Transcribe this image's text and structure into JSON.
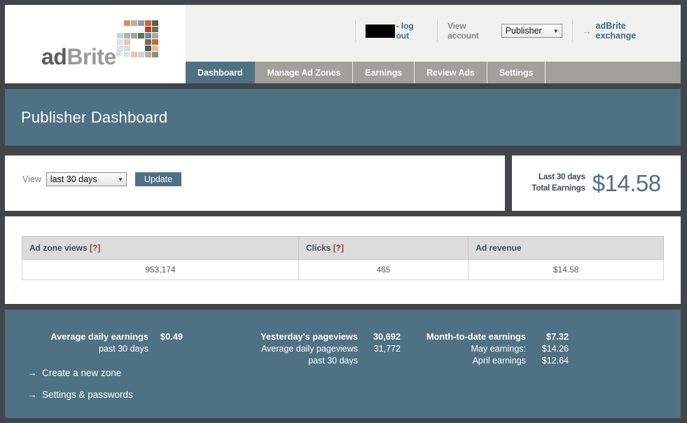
{
  "brand": {
    "logo_text_dark": "ad",
    "logo_text_light": "Brite",
    "logo_registered": "®",
    "logo_colors": [
      "#ffffff",
      "#d98f6a",
      "#b3b0a5",
      "#8aa0b0",
      "#c4673c",
      "#5a5c47",
      "#ffffff",
      "#ffffff",
      "#ffffff",
      "#ffffff",
      "#b5431a",
      "#6d6e55",
      "#c9d3da",
      "#b0b3ab",
      "#9ba79e",
      "#6d6e55",
      "#6b8ca3",
      "#a8a99c",
      "#dfe3e6",
      "#e7c6b4",
      "#ffffff",
      "#ffffff",
      "#6d6e55",
      "#c4673c",
      "#dfe3e6",
      "#d7dbde",
      "#ffffff",
      "#ffffff",
      "#5a5c47",
      "#e8b79c",
      "#ffffff",
      "#dfe3e6",
      "#e7c6b4",
      "#c9d3da",
      "#b3b0a5",
      "#8f9177"
    ]
  },
  "header": {
    "username_redacted": "",
    "logout_label": "- log out",
    "view_account_label": "View account",
    "account_select": {
      "value": "Publisher",
      "caret": "▼"
    },
    "exchange_arrow": "→",
    "exchange_label": "adBrite exchange"
  },
  "nav": {
    "tabs": [
      {
        "label": "Dashboard",
        "active": true
      },
      {
        "label": "Manage Ad Zones",
        "active": false
      },
      {
        "label": "Earnings",
        "active": false
      },
      {
        "label": "Review Ads",
        "active": false
      },
      {
        "label": "Settings",
        "active": false
      }
    ]
  },
  "page_title": "Publisher Dashboard",
  "view_panel": {
    "label": "View",
    "range_select": {
      "value": "last 30 days",
      "caret": "▼"
    },
    "update_label": "Update"
  },
  "earnings_summary": {
    "label_line1": "Last 30 days",
    "label_line2": "Total Earnings",
    "value": "$14.58"
  },
  "stats_table": {
    "columns": [
      {
        "label": "Ad zone views ",
        "help": "[?]"
      },
      {
        "label": "Clicks ",
        "help": "[?]"
      },
      {
        "label": "Ad revenue",
        "help": ""
      }
    ],
    "rows": [
      [
        "953,174",
        "465",
        "$14.58"
      ]
    ]
  },
  "bottom": {
    "col1": [
      {
        "label": "Average daily earnings",
        "value": "$0.49",
        "strong": true
      },
      {
        "label": "past 30 days",
        "value": "",
        "strong": false
      }
    ],
    "col2": [
      {
        "label": "Yesterday's pageviews",
        "value": "30,692",
        "strong": true
      },
      {
        "label": "Average daily pageviews",
        "value": "31,772",
        "strong": false
      },
      {
        "label": "past 30 days",
        "value": "",
        "strong": false
      }
    ],
    "col3": [
      {
        "label": "Month-to-date earnings",
        "value": "$7.32",
        "strong": true
      },
      {
        "label": "May earnings:",
        "value": "$14.26",
        "strong": false
      },
      {
        "label": "April earnings",
        "value": "$12.64",
        "strong": false
      }
    ],
    "links": [
      {
        "arrow": "→",
        "label": "Create a new zone"
      },
      {
        "arrow": "→",
        "label": "Settings & passwords"
      }
    ]
  },
  "colors": {
    "page_bg": "#42464b",
    "accent": "#4f7184",
    "nav_inactive": "#a2a09b",
    "link": "#3d6b87"
  }
}
